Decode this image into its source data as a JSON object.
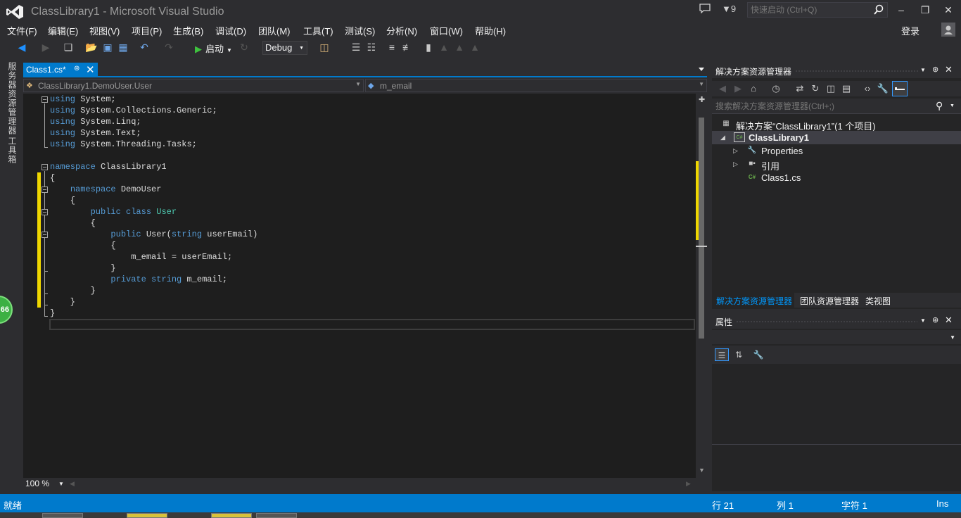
{
  "window": {
    "title": "ClassLibrary1 - Microsoft Visual Studio",
    "notification_count": "9",
    "quick_launch_placeholder": "快速启动 (Ctrl+Q)",
    "login_label": "登录"
  },
  "menu": [
    {
      "label": "文件(F)"
    },
    {
      "label": "编辑(E)"
    },
    {
      "label": "视图(V)"
    },
    {
      "label": "项目(P)"
    },
    {
      "label": "生成(B)"
    },
    {
      "label": "调试(D)"
    },
    {
      "label": "团队(M)"
    },
    {
      "label": "工具(T)"
    },
    {
      "label": "测试(S)"
    },
    {
      "label": "分析(N)"
    },
    {
      "label": "窗口(W)"
    },
    {
      "label": "帮助(H)"
    }
  ],
  "toolbar": {
    "start_label": "启动",
    "configuration": "Debug"
  },
  "left_strip": {
    "server_explorer": "服务器资源管理器",
    "toolbox": "工具箱",
    "badge": "66"
  },
  "editor": {
    "tab_label": "Class1.cs*",
    "nav_type": "ClassLibrary1.DemoUser.User",
    "nav_member": "m_email",
    "zoom": "100 %",
    "lines": [
      [
        {
          "t": "using",
          "c": "kw"
        },
        {
          "t": " System;",
          "c": ""
        }
      ],
      [
        {
          "t": "using",
          "c": "kw"
        },
        {
          "t": " System.Collections.Generic;",
          "c": ""
        }
      ],
      [
        {
          "t": "using",
          "c": "kw"
        },
        {
          "t": " System.Linq;",
          "c": ""
        }
      ],
      [
        {
          "t": "using",
          "c": "kw"
        },
        {
          "t": " System.Text;",
          "c": ""
        }
      ],
      [
        {
          "t": "using",
          "c": "kw"
        },
        {
          "t": " System.Threading.Tasks;",
          "c": ""
        }
      ],
      [],
      [
        {
          "t": "namespace",
          "c": "kw"
        },
        {
          "t": " ClassLibrary1",
          "c": ""
        }
      ],
      [
        {
          "t": "{",
          "c": ""
        }
      ],
      [
        {
          "t": "    ",
          "c": ""
        },
        {
          "t": "namespace",
          "c": "kw"
        },
        {
          "t": " DemoUser",
          "c": ""
        }
      ],
      [
        {
          "t": "    {",
          "c": ""
        }
      ],
      [
        {
          "t": "        ",
          "c": ""
        },
        {
          "t": "public",
          "c": "kw"
        },
        {
          "t": " ",
          "c": ""
        },
        {
          "t": "class",
          "c": "kw"
        },
        {
          "t": " ",
          "c": ""
        },
        {
          "t": "User",
          "c": "ty"
        }
      ],
      [
        {
          "t": "        {",
          "c": ""
        }
      ],
      [
        {
          "t": "            ",
          "c": ""
        },
        {
          "t": "public",
          "c": "kw"
        },
        {
          "t": " User(",
          "c": ""
        },
        {
          "t": "string",
          "c": "kw"
        },
        {
          "t": " userEmail)",
          "c": ""
        }
      ],
      [
        {
          "t": "            {",
          "c": ""
        }
      ],
      [
        {
          "t": "                m_email = userEmail;",
          "c": ""
        }
      ],
      [
        {
          "t": "            }",
          "c": ""
        }
      ],
      [
        {
          "t": "            ",
          "c": ""
        },
        {
          "t": "private",
          "c": "kw"
        },
        {
          "t": " ",
          "c": ""
        },
        {
          "t": "string",
          "c": "kw"
        },
        {
          "t": " m_email;",
          "c": ""
        }
      ],
      [
        {
          "t": "        }",
          "c": ""
        }
      ],
      [
        {
          "t": "    }",
          "c": ""
        }
      ],
      [
        {
          "t": "}",
          "c": ""
        }
      ]
    ]
  },
  "solution_explorer": {
    "title": "解决方案资源管理器",
    "search_placeholder": "搜索解决方案资源管理器(Ctrl+;)",
    "solution": "解决方案“ClassLibrary1”(1 个项目)",
    "project": "ClassLibrary1",
    "items": [
      {
        "label": "Properties"
      },
      {
        "label": "引用"
      },
      {
        "label": "Class1.cs"
      }
    ],
    "tabs": [
      {
        "label": "解决方案资源管理器"
      },
      {
        "label": "团队资源管理器"
      },
      {
        "label": "类视图"
      }
    ]
  },
  "properties": {
    "title": "属性"
  },
  "status": {
    "ready": "就绪",
    "line": "行 21",
    "column": "列 1",
    "char": "字符 1",
    "mode": "Ins"
  },
  "colors": {
    "accent": "#007acc",
    "keyword": "#569cd6",
    "type": "#4ec9b0",
    "change_marker": "#efd700"
  }
}
